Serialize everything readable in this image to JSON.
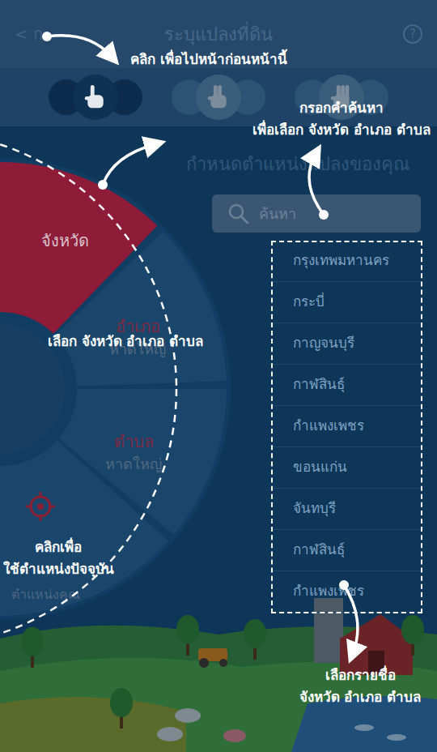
{
  "header": {
    "back": "< ก",
    "title": "ระบุแปลงที่ดิน",
    "help": "?"
  },
  "steps": [
    {
      "selected": true
    },
    {
      "selected": false
    },
    {
      "selected": false
    }
  ],
  "subtitle": "กำหนดตำแหน่งแปลงของคุณ",
  "search": {
    "placeholder": "ค้นหา"
  },
  "wheel": {
    "sectors": [
      {
        "label": "จังหวัด",
        "value": "",
        "selected": true
      },
      {
        "label": "อำเภอ",
        "value": "หาดใหญ่",
        "selected": false
      },
      {
        "label": "ตำบล",
        "value": "หาดใหญ่",
        "selected": false
      }
    ],
    "locate": "ตำแหน่งคุณ"
  },
  "provinces": [
    "กรุงเทพมหานคร",
    "กระบี่",
    "กาญจนบุรี",
    "กาฬสินธุ์",
    "กำแพงเพชร",
    "ขอนแก่น",
    "จันทบุรี",
    "กาฬสินธุ์",
    "กำแพงเพชร"
  ],
  "tips": {
    "back": [
      "คลิก เพื่อไปหน้าก่อนหน้านี้"
    ],
    "search": [
      "กรอกคำค้นหา",
      "เพื่อเลือก จังหวัด อำเภอ ตำบล"
    ],
    "wheel": [
      "เลือก จังหวัด อำเภอ ตำบล"
    ],
    "locate": [
      "คลิกเพื่อ",
      "ใช้ตำแหน่งปัจจุบัน"
    ],
    "list": [
      "เลือกรายชื่อ",
      "จังหวัด อำเภอ ตำบล"
    ]
  }
}
